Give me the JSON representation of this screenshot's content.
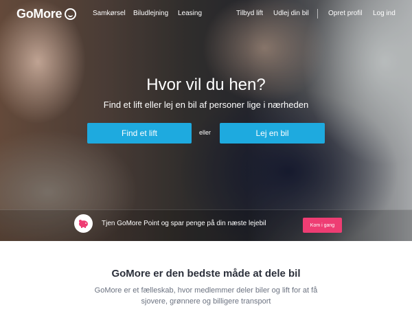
{
  "brand": {
    "name": "GoMore",
    "accent": "#1eaadf",
    "promo_color": "#ee3d73"
  },
  "nav": {
    "left": [
      "Samkørsel",
      "Biludlejning",
      "Leasing"
    ],
    "right": [
      "Tilbyd lift",
      "Udlej din bil",
      "Opret profil",
      "Log ind"
    ]
  },
  "hero": {
    "title": "Hvor vil du hen?",
    "subtitle": "Find et lift eller lej en bil af personer lige i nærheden",
    "find_lift_label": "Find et lift",
    "or_label": "eller",
    "rent_car_label": "Lej en bil"
  },
  "promo": {
    "text": "Tjen GoMore Point og spar penge på din næste lejebil",
    "button_label": "Kom i gang",
    "icon": "piggy-bank-icon"
  },
  "section": {
    "title": "GoMore er den bedste måde at dele bil",
    "line1": "GoMore er et fælleskab, hvor medlemmer deler biler og lift for at få",
    "line2": "sjovere, grønnere og billigere transport"
  }
}
